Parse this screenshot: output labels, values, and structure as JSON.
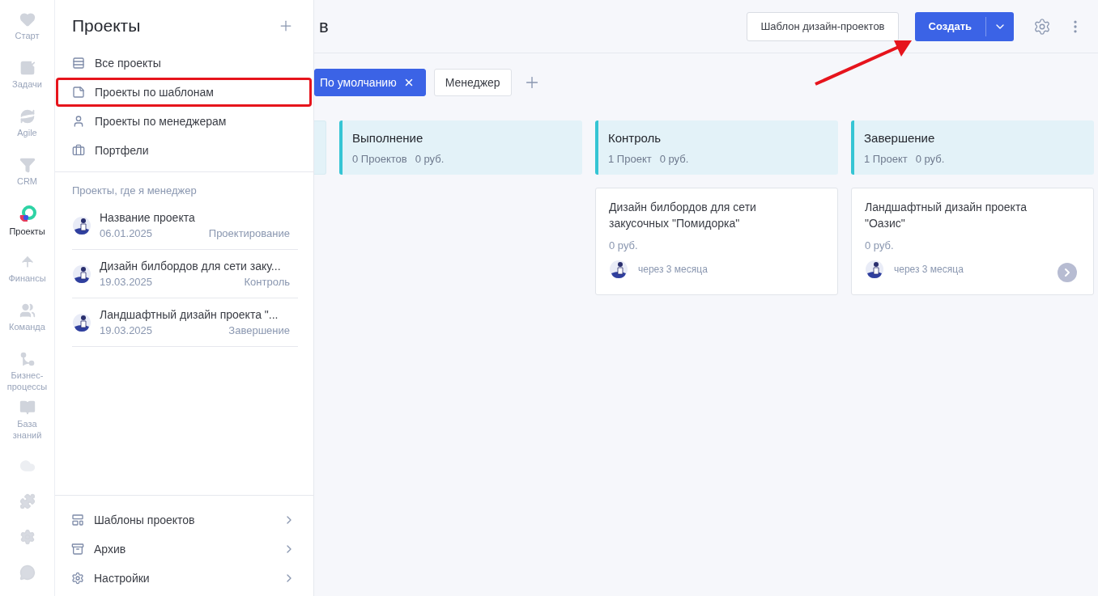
{
  "rail": [
    {
      "label": "Старт",
      "selected": false
    },
    {
      "label": "Задачи",
      "selected": false
    },
    {
      "label": "Agile",
      "selected": false
    },
    {
      "label": "CRM",
      "selected": false
    },
    {
      "label": "Проекты",
      "selected": true
    },
    {
      "label": "Финансы",
      "selected": false
    },
    {
      "label": "Команда",
      "selected": false
    },
    {
      "label": "Бизнес-процессы",
      "selected": false
    },
    {
      "label": "База знаний",
      "selected": false
    }
  ],
  "panel": {
    "title": "Проекты",
    "nav": [
      {
        "label": "Все проекты",
        "highlighted": false
      },
      {
        "label": "Проекты по шаблонам",
        "highlighted": true
      },
      {
        "label": "Проекты по менеджерам",
        "highlighted": false
      },
      {
        "label": "Портфели",
        "highlighted": false
      }
    ],
    "section_label": "Проекты, где я менеджер",
    "projects": [
      {
        "name": "Название проекта",
        "date": "06.01.2025",
        "stage": "Проектирование"
      },
      {
        "name": "Дизайн билбордов для сети заку...",
        "date": "19.03.2025",
        "stage": "Контроль"
      },
      {
        "name": "Ландшафтный дизайн проекта \"...",
        "date": "19.03.2025",
        "stage": "Завершение"
      }
    ],
    "footer": [
      {
        "label": "Шаблоны проектов"
      },
      {
        "label": "Архив"
      },
      {
        "label": "Настройки"
      }
    ]
  },
  "header": {
    "title": "в",
    "template_button": "Шаблон дизайн-проектов",
    "create_button": "Создать"
  },
  "filters": [
    {
      "label": "По умолчанию",
      "selected": true
    },
    {
      "label": "Менеджер",
      "selected": false
    }
  ],
  "columns": [
    {
      "title": "Выполнение",
      "count": "0 Проектов",
      "sum": "0 руб."
    },
    {
      "title": "Контроль",
      "count": "1 Проект",
      "sum": "0 руб.",
      "cards": [
        {
          "title": "Дизайн билбордов для сети закусочных \"Помидорка\"",
          "sum": "0 руб.",
          "due": "через 3 месяца",
          "open_button": false
        }
      ]
    },
    {
      "title": "Завершение",
      "count": "1 Проект",
      "sum": "0 руб.",
      "cards": [
        {
          "title": "Ландшафтный дизайн проекта \"Оазис\"",
          "sum": "0 руб.",
          "due": "через 3 месяца",
          "open_button": true
        }
      ]
    }
  ]
}
